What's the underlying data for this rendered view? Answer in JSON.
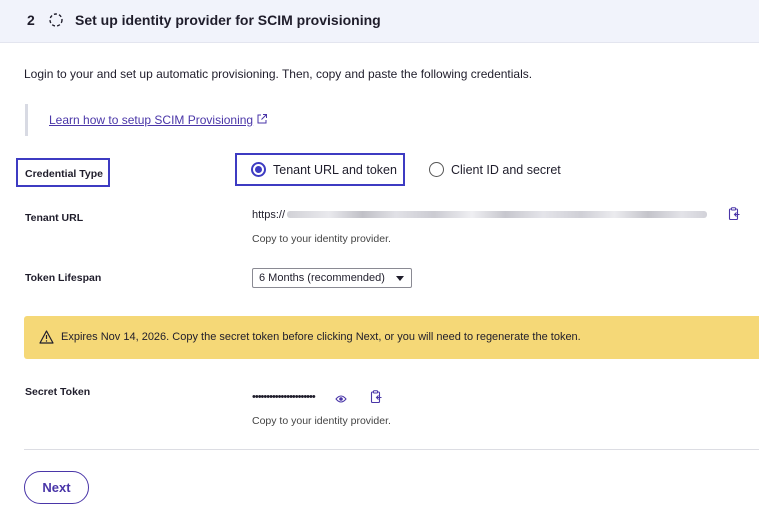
{
  "step": {
    "number": "2",
    "status_icon": "dashed-circle-icon",
    "title": "Set up identity provider for SCIM provisioning"
  },
  "intro_text": "Login to your and set up automatic provisioning. Then, copy and paste the following credentials.",
  "learn_link": {
    "label": "Learn how to setup SCIM Provisioning",
    "icon": "external-link-icon"
  },
  "credential_type": {
    "label": "Credential Type",
    "options": [
      {
        "label": "Tenant URL and token",
        "selected": true
      },
      {
        "label": "Client ID and secret",
        "selected": false
      }
    ]
  },
  "tenant_url": {
    "label": "Tenant URL",
    "value_prefix": "https://",
    "help": "Copy to your identity provider.",
    "icon": "copy-icon"
  },
  "token_lifespan": {
    "label": "Token Lifespan",
    "selected": "6 Months (recommended)"
  },
  "warning": {
    "icon": "warning-triangle-icon",
    "text": "Expires Nov 14, 2026. Copy the secret token before clicking Next, or you will need to regenerate the token."
  },
  "secret_token": {
    "label": "Secret Token",
    "masked_value": "••••••••••••••••••••••",
    "help": "Copy to your identity provider.",
    "icons": [
      "eye-icon",
      "copy-icon"
    ]
  },
  "next_button": {
    "label": "Next"
  },
  "colors": {
    "accent": "#3d3bc2",
    "link": "#4a36a8",
    "warning_bg": "#f5d877",
    "header_bg": "#f1f3fb"
  }
}
